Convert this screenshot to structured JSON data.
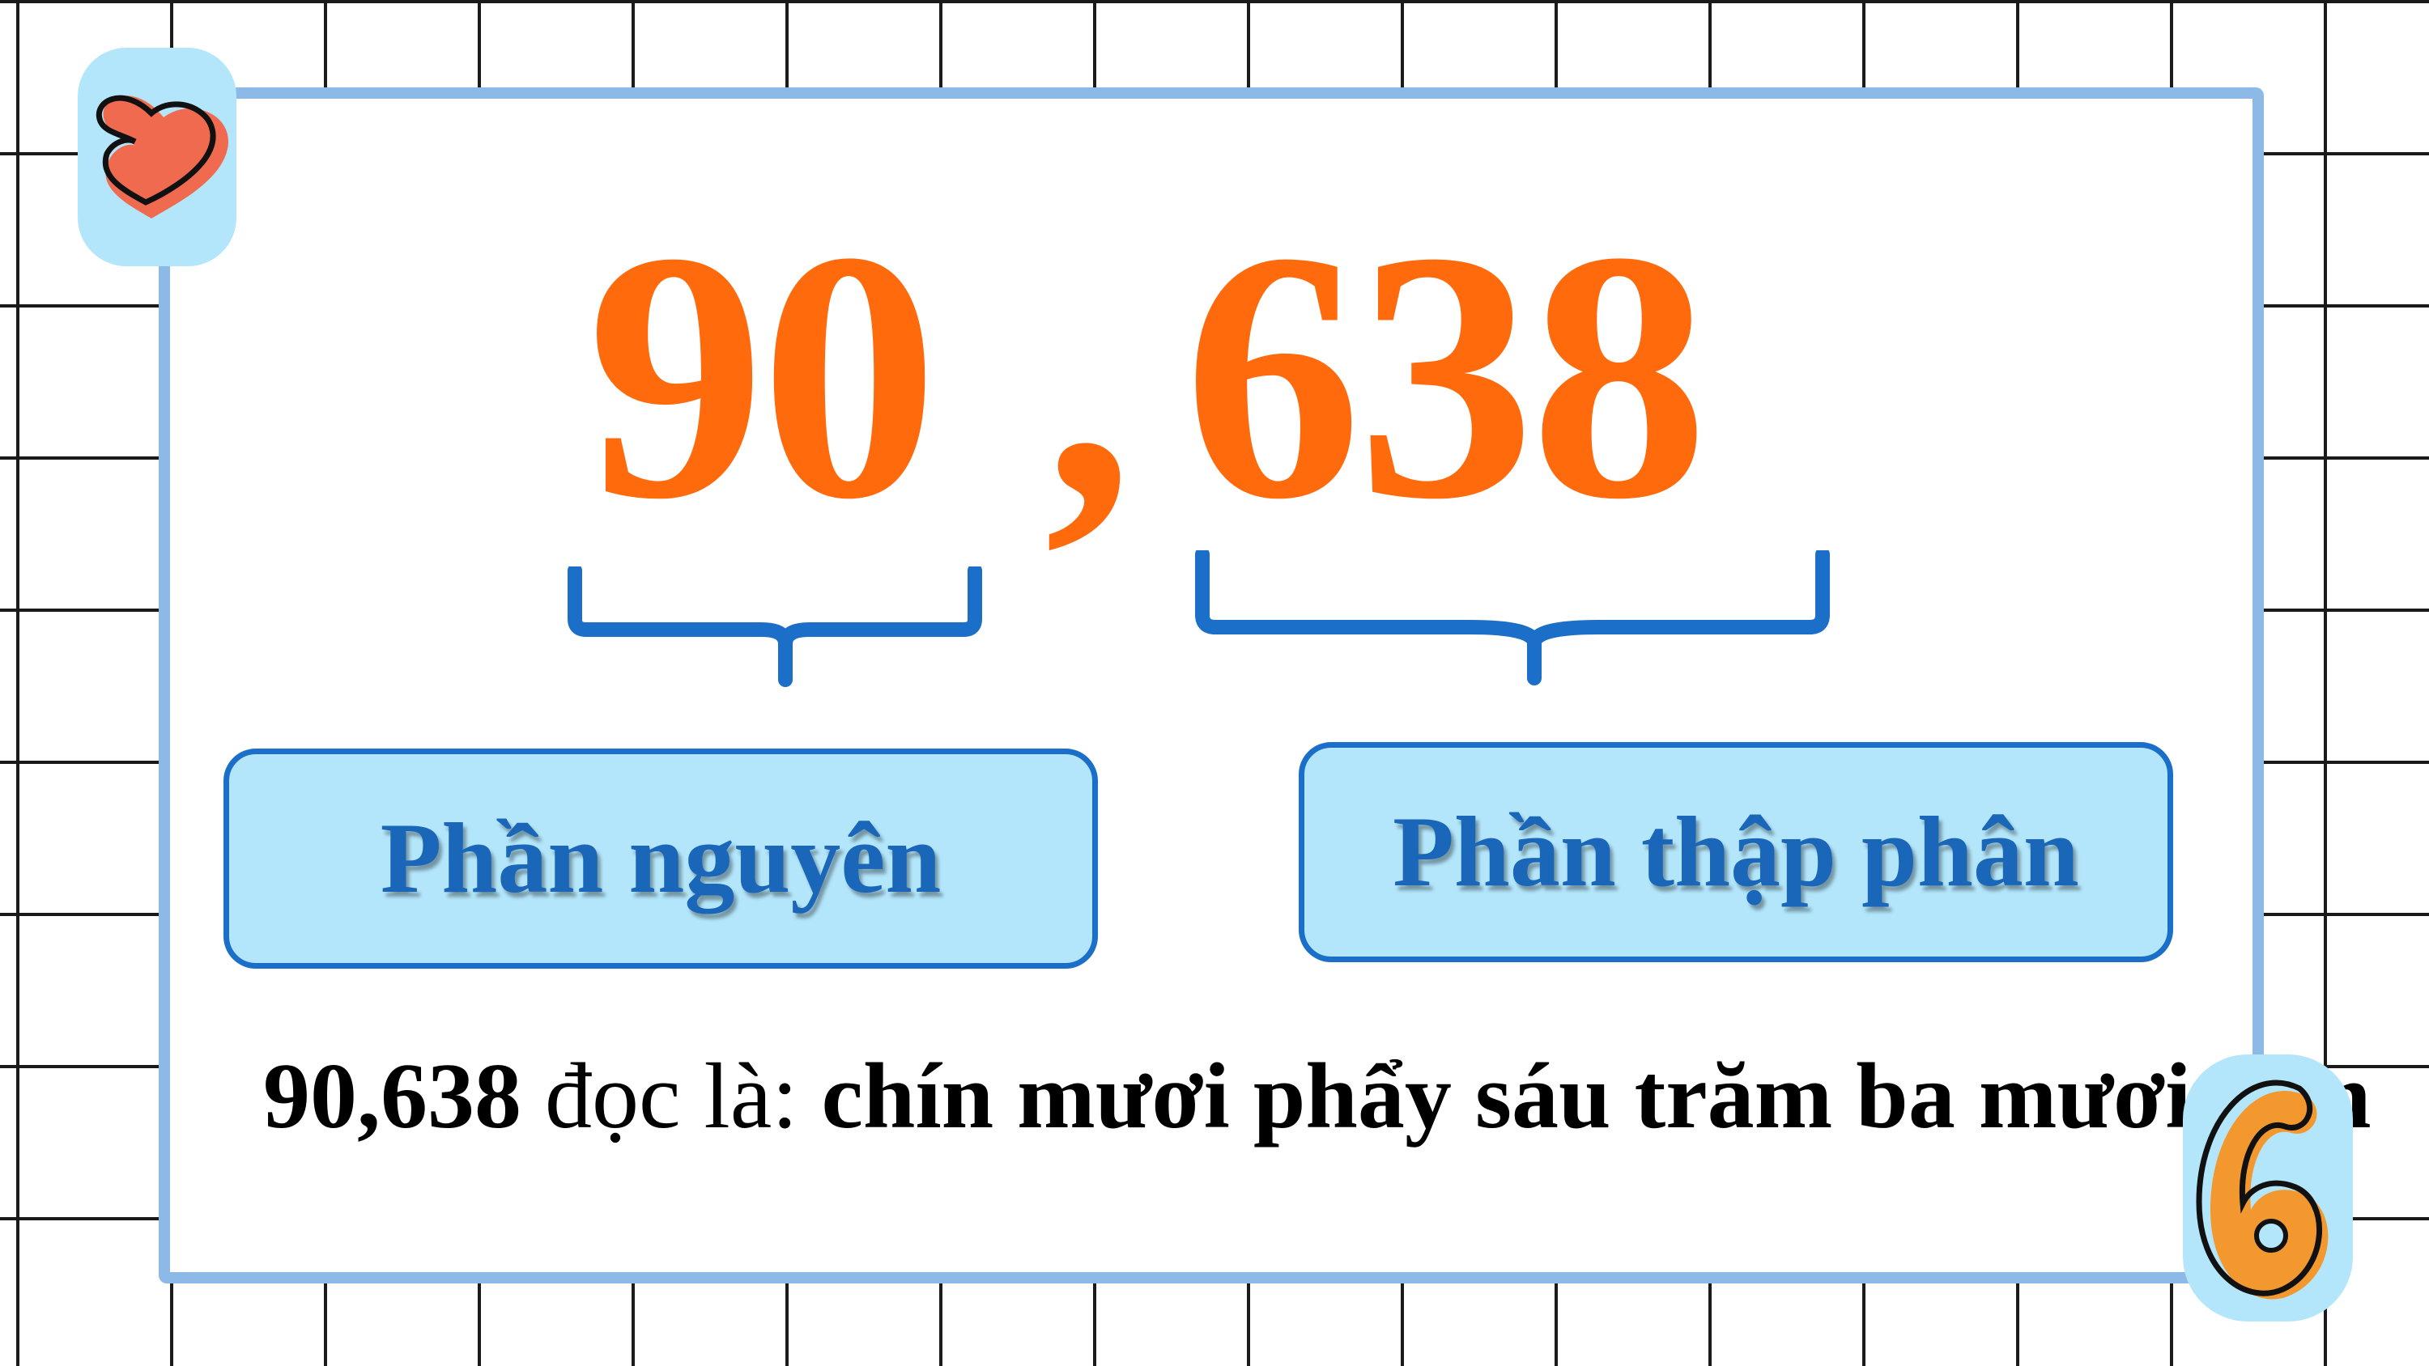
{
  "number": {
    "integer_part": "90",
    "comma": ",",
    "decimal_part": "638"
  },
  "labels": {
    "integer": "Phần nguyên",
    "decimal": "Phần thập phân"
  },
  "reading": {
    "number": "90,638",
    "connector": " đọc là: ",
    "words": "chín mươi phẩy sáu trăm ba mươi tám"
  },
  "decorations": {
    "top_left": "heart-icon",
    "bottom_right": "number-six-sticker"
  },
  "colors": {
    "number": "#ff6a0d",
    "label_text": "#1a66b8",
    "label_fill": "#b3e6fb",
    "frame": "#8db9e6"
  }
}
